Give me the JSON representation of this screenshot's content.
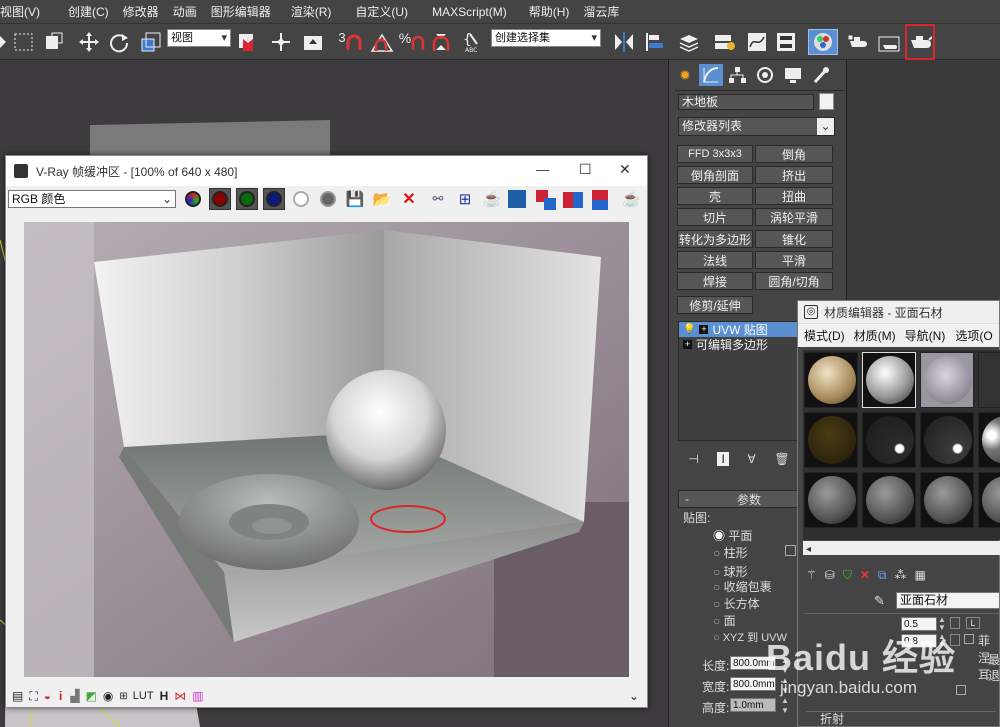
{
  "menubar": {
    "items": [
      "视图(V)",
      "创建(C)",
      "修改器",
      "动画",
      "图形编辑器",
      "渲染(R)",
      "自定义(U)",
      "MAXScript(M)",
      "帮助(H)",
      "溜云库"
    ]
  },
  "toolbar": {
    "view_dropdown": "视图",
    "selection_set_dropdown": "创建选择集",
    "snap_label_3": "3",
    "snap_label_percent": "%",
    "colors": {
      "highlight_box": "#d9262c",
      "active_button": "#5b8fd0"
    }
  },
  "vray": {
    "title": "V-Ray 帧缓冲区 - [100% of 640 x 480]",
    "channel_dropdown": "RGB 颜色",
    "window_controls": {
      "minimize": "—",
      "maximize": "☐",
      "close": "✕"
    },
    "bottom_tools": [
      "LUT",
      "H"
    ]
  },
  "command_panel": {
    "object_name": "木地板",
    "modifier_list": "修改器列表",
    "modifier_buttons": [
      [
        "FFD 3x3x3",
        "倒角"
      ],
      [
        "倒角剖面",
        "挤出"
      ],
      [
        "壳",
        "扭曲"
      ],
      [
        "切片",
        "涡轮平滑"
      ],
      [
        "转化为多边形",
        "锥化"
      ],
      [
        "法线",
        "平滑"
      ],
      [
        "焊接",
        "圆角/切角"
      ],
      [
        "修剪/延伸",
        ""
      ]
    ],
    "stack": [
      "UVW 贴图",
      "可编辑多边形"
    ],
    "rollout_title": "参数",
    "mapping_group": "贴图:",
    "mapping_options": [
      "平面",
      "柱形",
      "球形",
      "收缩包裹",
      "长方体",
      "面",
      "XYZ 到 UVW"
    ],
    "length_label": "长度:",
    "length_value": "800.0mm",
    "width_label": "宽度:",
    "width_value": "800.0mm",
    "height_label": "高度:",
    "height_value": "1.0mm"
  },
  "material_editor": {
    "title": "材质编辑器 - 亚面石材",
    "menu": [
      "模式(D)",
      "材质(M)",
      "导航(N)",
      "选项(O"
    ],
    "material_name": "亚面石材",
    "glossiness_value": "0.5",
    "glossiness_lock": "L",
    "param_value_2": "0.8",
    "fresnel_label": "菲涅耳",
    "partial_labels": [
      "最",
      "退"
    ],
    "refraction_label": "折射"
  },
  "watermark": {
    "text": "Baidu 经验",
    "url": "jingyan.baidu.com"
  }
}
